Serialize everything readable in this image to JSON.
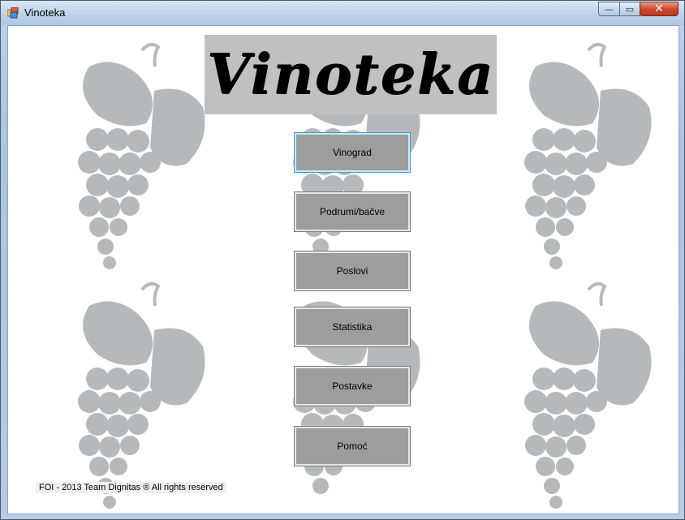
{
  "window": {
    "title": "Vinoteka",
    "minimize_glyph": "—",
    "maximize_glyph": "▭",
    "close_glyph": "✕"
  },
  "logo": {
    "text": "Vinoteka"
  },
  "menu": [
    {
      "label": "Vinograd"
    },
    {
      "label": "Podrumi/bačve"
    },
    {
      "label": "Poslovi"
    },
    {
      "label": "Statistika"
    },
    {
      "label": "Postavke"
    },
    {
      "label": "Pomoć"
    }
  ],
  "footer": {
    "text": "FOI - 2013 Team Dignitas  ® All rights reserved"
  },
  "colors": {
    "button_face": "#9d9d9d",
    "logo_background": "#c0c0c0",
    "grape_watermark": "#a9adb0"
  },
  "icons": {
    "app": "app-window-icon",
    "background": "grape-watermark"
  }
}
